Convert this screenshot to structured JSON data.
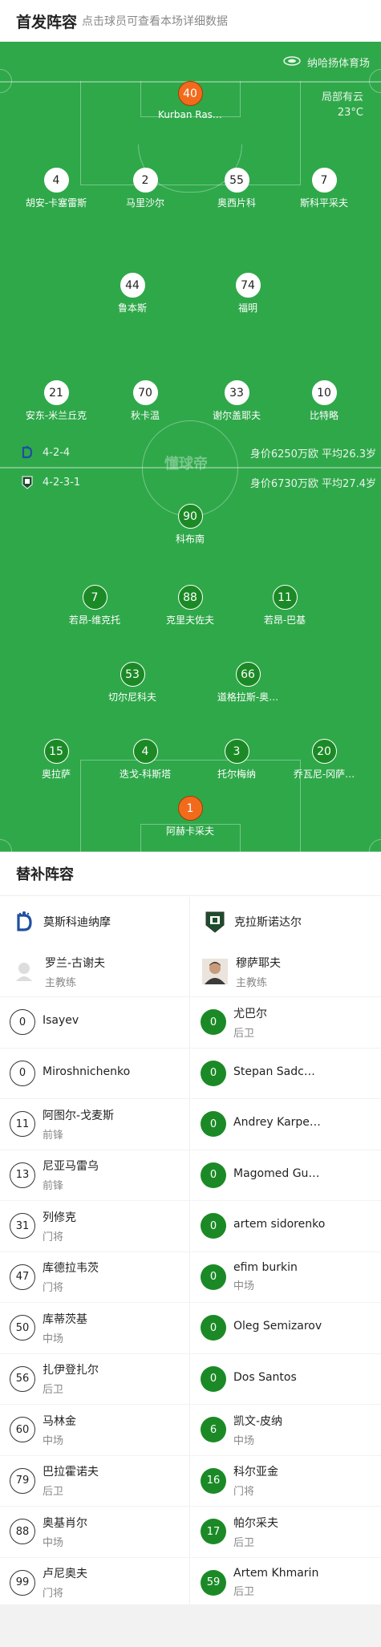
{
  "header": {
    "title": "首发阵容",
    "subtitle": "点击球员可查看本场详细数据"
  },
  "venue": {
    "name": "纳哈扬体育场",
    "weather": "局部有云",
    "temperature": "23°C"
  },
  "watermark": "懂球帝",
  "home": {
    "formation": "4-2-4",
    "value": "身价6250万欧 平均26.3岁",
    "players": [
      {
        "num": "40",
        "name": "Kurban Ras…",
        "gk": true
      },
      {
        "num": "4",
        "name": "胡安-卡塞雷斯"
      },
      {
        "num": "2",
        "name": "马里沙尔"
      },
      {
        "num": "55",
        "name": "奥西片科"
      },
      {
        "num": "7",
        "name": "斯科平采夫"
      },
      {
        "num": "44",
        "name": "鲁本斯"
      },
      {
        "num": "74",
        "name": "福明"
      },
      {
        "num": "21",
        "name": "安东-米兰丘克"
      },
      {
        "num": "70",
        "name": "秋卡温"
      },
      {
        "num": "33",
        "name": "谢尔盖耶夫"
      },
      {
        "num": "10",
        "name": "比特略"
      }
    ]
  },
  "away": {
    "formation": "4-2-3-1",
    "value": "身价6730万欧 平均27.4岁",
    "players": [
      {
        "num": "90",
        "name": "科布南"
      },
      {
        "num": "7",
        "name": "若昂-维克托"
      },
      {
        "num": "88",
        "name": "克里夫佐夫"
      },
      {
        "num": "11",
        "name": "若昂-巴基"
      },
      {
        "num": "53",
        "name": "切尔尼科夫"
      },
      {
        "num": "66",
        "name": "道格拉斯-奥…"
      },
      {
        "num": "15",
        "name": "奥拉萨"
      },
      {
        "num": "4",
        "name": "迭戈-科斯塔"
      },
      {
        "num": "3",
        "name": "托尔梅纳"
      },
      {
        "num": "20",
        "name": "乔瓦尼-冈萨…"
      },
      {
        "num": "1",
        "name": "阿赫卡采夫",
        "gk": true
      }
    ]
  },
  "subs": {
    "title": "替补阵容",
    "left": {
      "team": "莫斯科迪纳摩",
      "coach": {
        "name": "罗兰-古谢夫",
        "role": "主教练"
      },
      "players": [
        {
          "num": "0",
          "name": "Isayev",
          "pos": ""
        },
        {
          "num": "0",
          "name": "Miroshnichenko",
          "pos": ""
        },
        {
          "num": "11",
          "name": "阿图尔-戈麦斯",
          "pos": "前锋"
        },
        {
          "num": "13",
          "name": "尼亚马雷乌",
          "pos": "前锋"
        },
        {
          "num": "31",
          "name": "列修克",
          "pos": "门将"
        },
        {
          "num": "47",
          "name": "库德拉韦茨",
          "pos": "门将"
        },
        {
          "num": "50",
          "name": "库蒂茨基",
          "pos": "中场"
        },
        {
          "num": "56",
          "name": "扎伊登扎尔",
          "pos": "后卫"
        },
        {
          "num": "60",
          "name": "马林金",
          "pos": "中场"
        },
        {
          "num": "79",
          "name": "巴拉霍诺夫",
          "pos": "后卫"
        },
        {
          "num": "88",
          "name": "奥基肖尔",
          "pos": "中场"
        },
        {
          "num": "99",
          "name": "卢尼奥夫",
          "pos": "门将"
        }
      ]
    },
    "right": {
      "team": "克拉斯诺达尔",
      "coach": {
        "name": "穆萨耶夫",
        "role": "主教练"
      },
      "players": [
        {
          "num": "0",
          "name": "尤巴尔",
          "pos": "后卫"
        },
        {
          "num": "0",
          "name": "Stepan Sadc…",
          "pos": ""
        },
        {
          "num": "0",
          "name": "Andrey Karpe…",
          "pos": ""
        },
        {
          "num": "0",
          "name": "Magomed Gu…",
          "pos": ""
        },
        {
          "num": "0",
          "name": "artem sidorenko",
          "pos": ""
        },
        {
          "num": "0",
          "name": "efim burkin",
          "pos": "中场"
        },
        {
          "num": "0",
          "name": "Oleg Semizarov",
          "pos": ""
        },
        {
          "num": "0",
          "name": "Dos Santos",
          "pos": ""
        },
        {
          "num": "6",
          "name": "凯文-皮纳",
          "pos": "中场"
        },
        {
          "num": "16",
          "name": "科尔亚金",
          "pos": "门将"
        },
        {
          "num": "17",
          "name": "帕尔采夫",
          "pos": "后卫"
        },
        {
          "num": "59",
          "name": "Artem Khmarin",
          "pos": "后卫"
        }
      ]
    }
  },
  "colors": {
    "pitch": "#2fa84a",
    "away_badge": "#1b8a26",
    "gk_badge": "#f26b1d"
  }
}
